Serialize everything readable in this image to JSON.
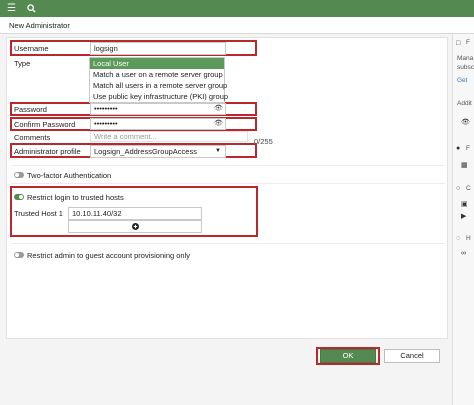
{
  "topbar": {
    "menu_icon": "hamburger-menu-icon",
    "search_icon": "search-icon"
  },
  "title": "New Administrator",
  "form": {
    "username_label": "Username",
    "username_value": "logsign",
    "type_label": "Type",
    "type_options": [
      "Local User",
      "Match a user on a remote server group",
      "Match all users in a remote server group",
      "Use public key infrastructure (PKI) group"
    ],
    "password_label": "Password",
    "password_value": "•••••••••",
    "confirm_label": "Confirm Password",
    "confirm_value": "•••••••••",
    "comments_label": "Comments",
    "comments_placeholder": "Write a comment...",
    "comments_count": "0/255",
    "profile_label": "Administrator profile",
    "profile_value": "Logsign_AddressGroupAccess",
    "twofactor_label": "Two-factor Authentication",
    "restrict_label": "Restrict login to trusted hosts",
    "trusted_host_label": "Trusted Host 1",
    "trusted_host_value": "10.10.11.40/32",
    "guest_label": "Restrict admin to guest account provisioning only"
  },
  "buttons": {
    "ok": "OK",
    "cancel": "Cancel"
  },
  "colors": {
    "accent": "#548a52",
    "highlight": "#b8282c"
  },
  "right_panel": {
    "t1": "F",
    "t2": "Mana",
    "t3": "subsc",
    "t4": "Get",
    "t5": "Addit",
    "t6": "F",
    "t7": "C",
    "t8": "H"
  }
}
